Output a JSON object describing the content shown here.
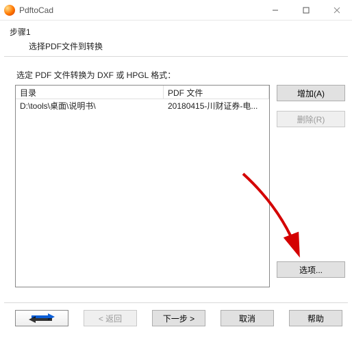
{
  "titlebar": {
    "title": "PdftoCad"
  },
  "step": {
    "label": "步骤1",
    "desc": "选择PDF文件到转换"
  },
  "prompt": "选定 PDF 文件转换为 DXF 或 HPGL 格式：",
  "columns": {
    "dir": "目录",
    "file": "PDF 文件"
  },
  "rows": [
    {
      "dir": "D:\\tools\\桌面\\说明书\\",
      "file": "20180415-川财证券-电..."
    }
  ],
  "buttons": {
    "add": "增加(A)",
    "remove": "删除(R)",
    "options": "选项...",
    "back": "< 返回",
    "next": "下一步 >",
    "cancel": "取消",
    "help": "帮助"
  }
}
